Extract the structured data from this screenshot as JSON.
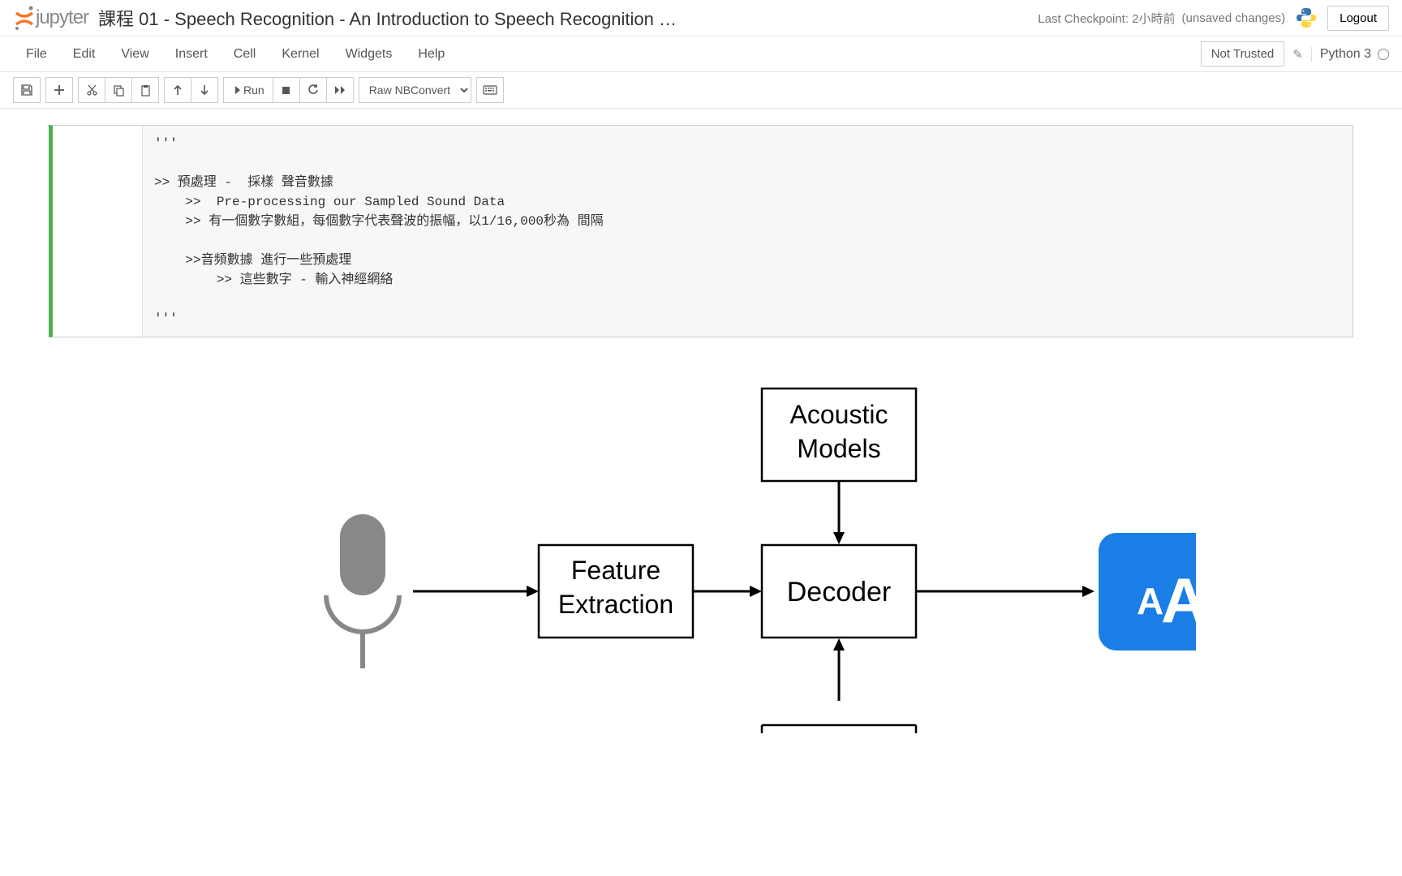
{
  "header": {
    "logo_text": "jupyter",
    "title": "課程 01 - Speech Recognition - An Introduction to Speech Recognition …",
    "checkpoint": "Last Checkpoint: 2小時前",
    "changes": "(unsaved changes)",
    "logout": "Logout"
  },
  "menubar": {
    "items": [
      "File",
      "Edit",
      "View",
      "Insert",
      "Cell",
      "Kernel",
      "Widgets",
      "Help"
    ],
    "not_trusted": "Not Trusted",
    "kernel": "Python 3"
  },
  "toolbar": {
    "run_label": "Run",
    "cell_type": "Raw NBConvert"
  },
  "cell": {
    "code": "'''\n\n>> 預處理 -  採樣 聲音數據\n    >>  Pre-processing our Sampled Sound Data\n    >> 有一個數字數組，每個數字代表聲波的振幅，以1/16,000秒為 間隔\n\n    >>音頻數據 進行一些預處理\n        >> 這些數字 - 輸入神經網絡\n\n'''"
  },
  "diagram": {
    "acoustic_line1": "Acoustic",
    "acoustic_line2": "Models",
    "feature_line1": "Feature",
    "feature_line2": "Extraction",
    "decoder": "Decoder"
  }
}
